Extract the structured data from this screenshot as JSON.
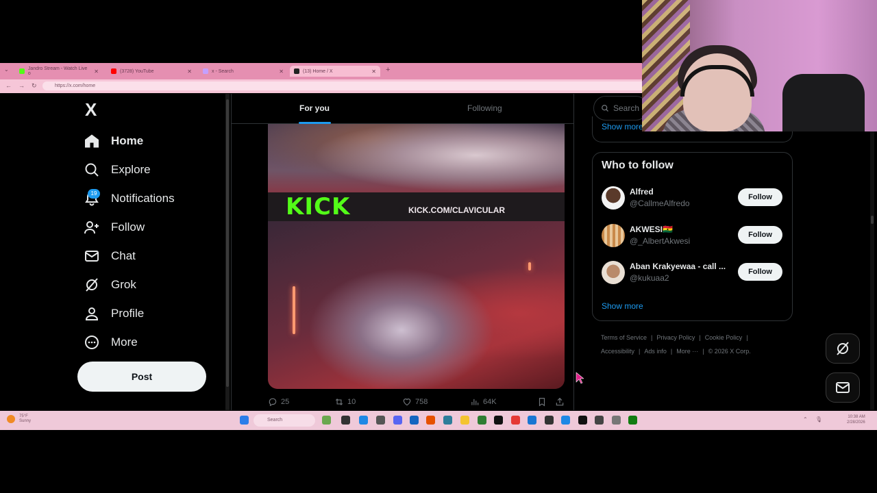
{
  "browser": {
    "tabs": [
      {
        "label": "Jandro Stream - Watch Live o",
        "color": "#53fc18"
      },
      {
        "label": "(3728) YouTube",
        "color": "#ff0000"
      },
      {
        "label": "x - Search",
        "color": "#c4a0ff"
      },
      {
        "label": "(13) Home / X",
        "color": "#222222"
      }
    ],
    "new_tab": "+",
    "url": "https://x.com/home"
  },
  "sidebar": {
    "logo": "X",
    "notifications_badge": "19",
    "items": [
      {
        "label": "Home",
        "icon": "home-icon"
      },
      {
        "label": "Explore",
        "icon": "search-icon"
      },
      {
        "label": "Notifications",
        "icon": "bell-icon"
      },
      {
        "label": "Follow",
        "icon": "person-add-icon"
      },
      {
        "label": "Chat",
        "icon": "mail-icon"
      },
      {
        "label": "Grok",
        "icon": "grok-icon"
      },
      {
        "label": "Profile",
        "icon": "person-icon"
      },
      {
        "label": "More",
        "icon": "more-circle-icon"
      }
    ],
    "post_label": "Post"
  },
  "timeline": {
    "tabs": [
      "For you",
      "Following"
    ],
    "active_tab": "For you",
    "media": {
      "overlay_brand": "KICK",
      "overlay_url": "KICK.COM/CLAVICULAR"
    },
    "actions": {
      "replies": "25",
      "reposts": "10",
      "likes": "758",
      "views": "64K"
    }
  },
  "right": {
    "search_placeholder": "Search",
    "show_more_top": "Show more",
    "who_to_follow_title": "Who to follow",
    "accounts": [
      {
        "name": "Alfred",
        "handle": "@CallmeAlfredo",
        "button": "Follow"
      },
      {
        "name": "AKWESI🇬🇭",
        "handle": "@_AlbertAkwesi",
        "button": "Follow"
      },
      {
        "name": "Aban Krakyewaa - call ...",
        "handle": "@kukuaa2",
        "button": "Follow"
      }
    ],
    "show_more": "Show more",
    "footer_line1": [
      "Terms of Service",
      "Privacy Policy",
      "Cookie Policy"
    ],
    "footer_line2": [
      "Accessibility",
      "Ads info",
      "More ···",
      "© 2026 X Corp."
    ]
  },
  "taskbar": {
    "weather_temp": "75°F",
    "weather_desc": "Sunny",
    "search": "Search",
    "time": "10:38 AM",
    "date": "2/28/2026"
  },
  "colors": {
    "accent": "#1d9bf0",
    "kick_green": "#53fc18",
    "chrome_pink": "#e58fb1"
  }
}
